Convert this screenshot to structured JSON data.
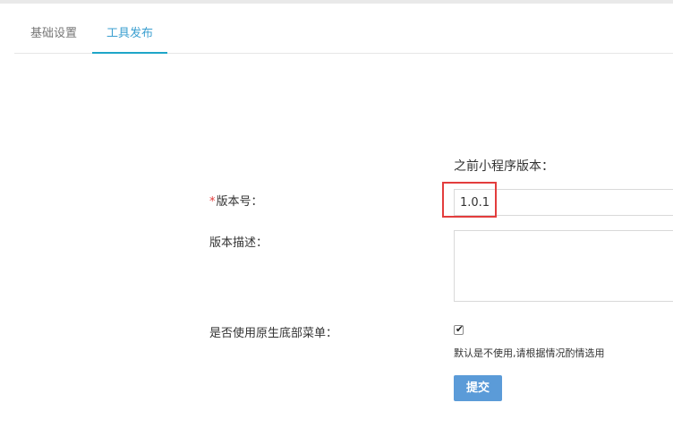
{
  "tabs": [
    {
      "label": "基础设置",
      "active": false
    },
    {
      "label": "工具发布",
      "active": true
    }
  ],
  "form": {
    "previous_version_label": "之前小程序版本：",
    "version": {
      "required_mark": "*",
      "label": "版本号：",
      "value": "1.0.1"
    },
    "description": {
      "label": "版本描述：",
      "value": ""
    },
    "native_menu": {
      "label": "是否使用原生底部菜单：",
      "checked": true,
      "check_glyph": "✔",
      "hint": "默认是不使用,请根据情况酌情选用"
    },
    "submit_label": "提交"
  },
  "colors": {
    "accent": "#1ea6c8",
    "active_tab_text": "#3b9fd0",
    "submit_button": "#5b9bd8",
    "highlight_border": "#e33d3d",
    "required_mark": "#e23b3b"
  }
}
